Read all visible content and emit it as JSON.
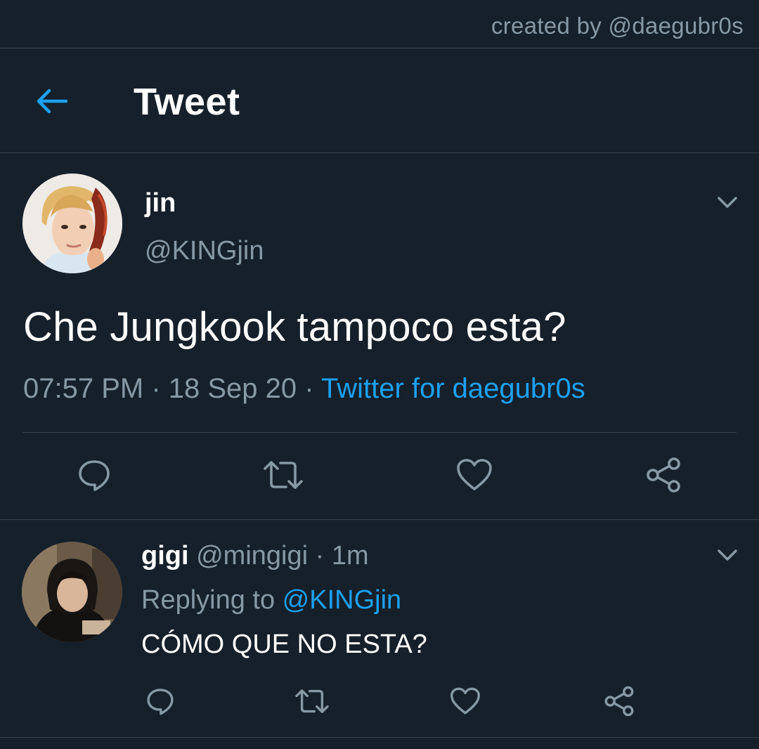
{
  "watermark": "created by @daegubr0s",
  "header": {
    "title": "Tweet",
    "back_icon": "arrow-left-icon"
  },
  "tweet": {
    "author_name": "jin",
    "author_handle": "@KINGjin",
    "text": "Che Jungkook tampoco esta?",
    "time": "07:57 PM",
    "separator": " · ",
    "date": "18 Sep 20",
    "source": "Twitter for daegubr0s",
    "actions": [
      "reply-icon",
      "retweet-icon",
      "like-icon",
      "share-icon"
    ]
  },
  "reply": {
    "author_name": "gigi",
    "author_handle": "@mingigi",
    "separator": " · ",
    "age": "1m",
    "replying_prefix": "Replying to ",
    "replying_to": "@KINGjin",
    "text": "CÓMO QUE NO ESTA?",
    "actions": [
      "reply-icon",
      "retweet-icon",
      "like-icon",
      "share-icon"
    ]
  },
  "colors": {
    "background": "#15202b",
    "accent": "#1da1f2",
    "secondary_text": "#8899a6",
    "divider": "#38444d"
  }
}
